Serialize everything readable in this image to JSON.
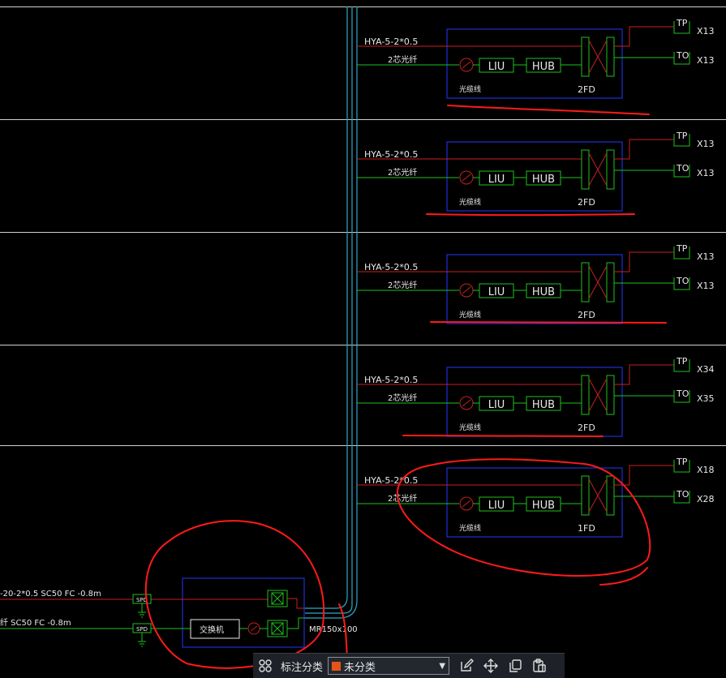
{
  "colors": {
    "background": "#000000",
    "separator": "#d0d0d0",
    "riser": "#2fa8c8",
    "copper": "#c8201e",
    "fiber": "#20c020",
    "cabinet": "#1d2fd6",
    "outlet": "#20c020",
    "markup": "#ff1a1a",
    "text": "#e8e8e8",
    "toolbar_bg": "#1e2228",
    "swatch": "#e8531a"
  },
  "floors": [
    {
      "cable": "HYA-5-2*0.5",
      "fiber": "2芯光纤",
      "liu": "LIU",
      "hub": "HUB",
      "cabinet_note": "光缆线",
      "distributor": "2FD",
      "tp": "TP",
      "tp_count": "X13",
      "to": "TO",
      "to_count": "X13"
    },
    {
      "cable": "HYA-5-2*0.5",
      "fiber": "2芯光纤",
      "liu": "LIU",
      "hub": "HUB",
      "cabinet_note": "光缆线",
      "distributor": "2FD",
      "tp": "TP",
      "tp_count": "X13",
      "to": "TO",
      "to_count": "X13"
    },
    {
      "cable": "HYA-5-2*0.5",
      "fiber": "2芯光纤",
      "liu": "LIU",
      "hub": "HUB",
      "cabinet_note": "光缆线",
      "distributor": "2FD",
      "tp": "TP",
      "tp_count": "X13",
      "to": "TO",
      "to_count": "X13"
    },
    {
      "cable": "HYA-5-2*0.5",
      "fiber": "2芯光纤",
      "liu": "LIU",
      "hub": "HUB",
      "cabinet_note": "光缆线",
      "distributor": "2FD",
      "tp": "TP",
      "tp_count": "X34",
      "to": "TO",
      "to_count": "X35"
    },
    {
      "cable": "HYA-5-2*0.5",
      "fiber": "2芯光纤",
      "liu": "LIU",
      "hub": "HUB",
      "cabinet_note": "光缆线",
      "distributor": "1FD",
      "tp": "TP",
      "tp_count": "X18",
      "to": "TO",
      "to_count": "X28"
    }
  ],
  "main_room": {
    "incoming_copper": "-20-2*0.5  SC50  FC -0.8m",
    "incoming_fiber": "纤  SC50  FC -0.8m",
    "spd1": "SPD",
    "spd2": "SPD",
    "switch_label": "交换机",
    "riser_label": "MR150x100"
  },
  "toolbar": {
    "group_icon": "group-icon",
    "label": "标注分类",
    "selected": "未分类",
    "options_icon": "chevron-down-icon",
    "icons": [
      "edit-icon",
      "move-icon",
      "copy-icon",
      "paste-icon"
    ]
  }
}
